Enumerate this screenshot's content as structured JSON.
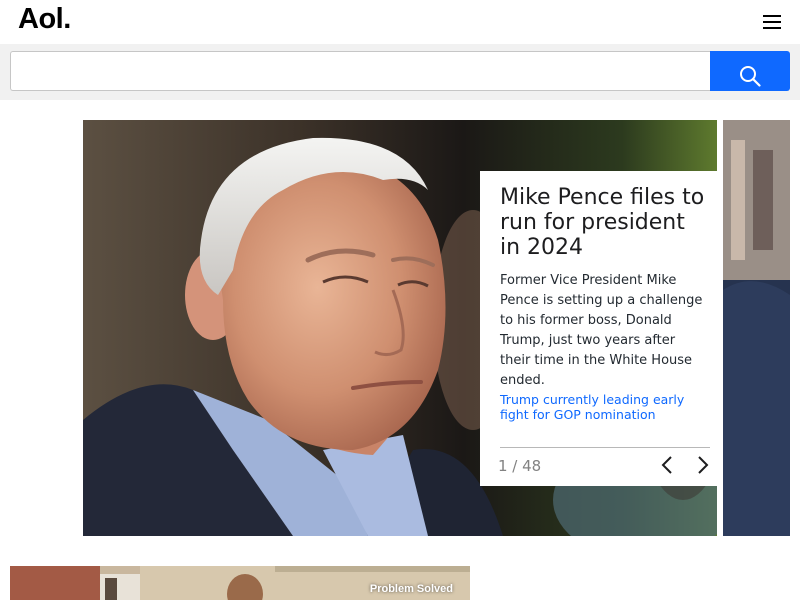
{
  "header": {
    "logo": "Aol.",
    "menu_icon": "hamburger-menu-icon"
  },
  "search": {
    "placeholder": "",
    "value": "",
    "button_icon": "search-icon",
    "button_color": "#0f69ff"
  },
  "slideshow": {
    "headline": "Mike Pence files to run for president in 2024",
    "summary": "Former Vice President Mike Pence is setting up a challenge to his former boss, Donald Trump, just two years after their time in the White House ended.",
    "related_link": "Trump currently leading early fight for GOP nomination",
    "counter": "1 / 48",
    "prev_icon": "chevron-left-icon",
    "next_icon": "chevron-right-icon"
  },
  "teaser": {
    "tag": "Problem Solved"
  },
  "colors": {
    "accent": "#0f69ff",
    "search_band": "#f1f1f1",
    "headline": "#1d1d1f",
    "link": "#0f69ff"
  }
}
